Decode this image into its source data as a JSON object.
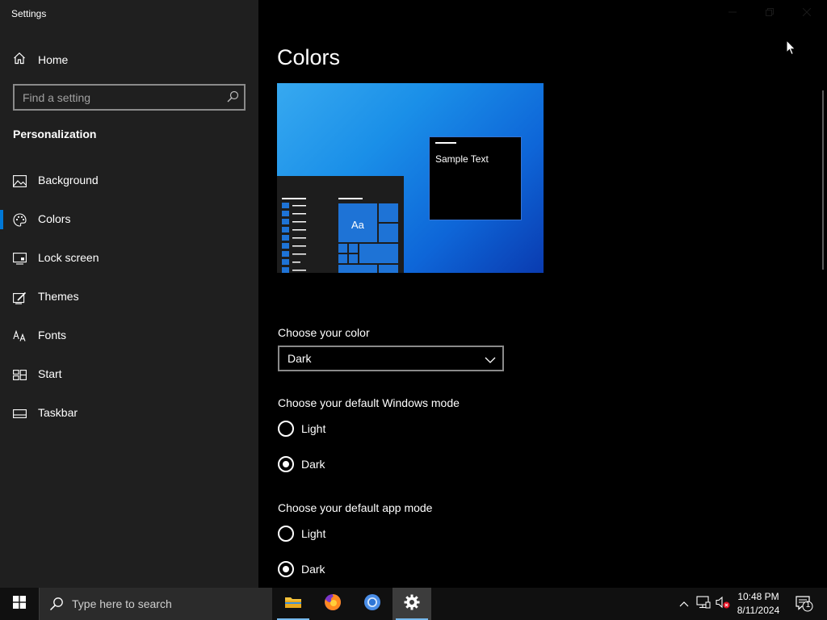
{
  "window": {
    "title": "Settings"
  },
  "sidebar": {
    "home_label": "Home",
    "search_placeholder": "Find a setting",
    "section_title": "Personalization",
    "items": [
      {
        "label": "Background",
        "icon": "image-icon",
        "selected": false
      },
      {
        "label": "Colors",
        "icon": "palette-icon",
        "selected": true
      },
      {
        "label": "Lock screen",
        "icon": "lock-screen-icon",
        "selected": false
      },
      {
        "label": "Themes",
        "icon": "themes-icon",
        "selected": false
      },
      {
        "label": "Fonts",
        "icon": "fonts-icon",
        "selected": false
      },
      {
        "label": "Start",
        "icon": "start-icon",
        "selected": false
      },
      {
        "label": "Taskbar",
        "icon": "taskbar-icon",
        "selected": false
      }
    ]
  },
  "main": {
    "title": "Colors",
    "preview": {
      "sample_text": "Sample Text",
      "tile_text": "Aa"
    },
    "choose_color_label": "Choose your color",
    "choose_color_value": "Dark",
    "windows_mode": {
      "label": "Choose your default Windows mode",
      "options": [
        "Light",
        "Dark"
      ],
      "selected": "Dark"
    },
    "app_mode": {
      "label": "Choose your default app mode",
      "options": [
        "Light",
        "Dark"
      ],
      "selected": "Dark"
    }
  },
  "taskbar": {
    "search_placeholder": "Type here to search",
    "apps": [
      "file-explorer-icon",
      "firefox-icon",
      "chromium-icon",
      "settings-icon"
    ],
    "time": "10:48 PM",
    "date": "8/11/2024",
    "notification_count": "1"
  },
  "colors": {
    "accent": "#0078d7",
    "sidebar_bg": "#1f1f1f",
    "main_bg": "#000000",
    "taskbar_bg": "#101010"
  }
}
